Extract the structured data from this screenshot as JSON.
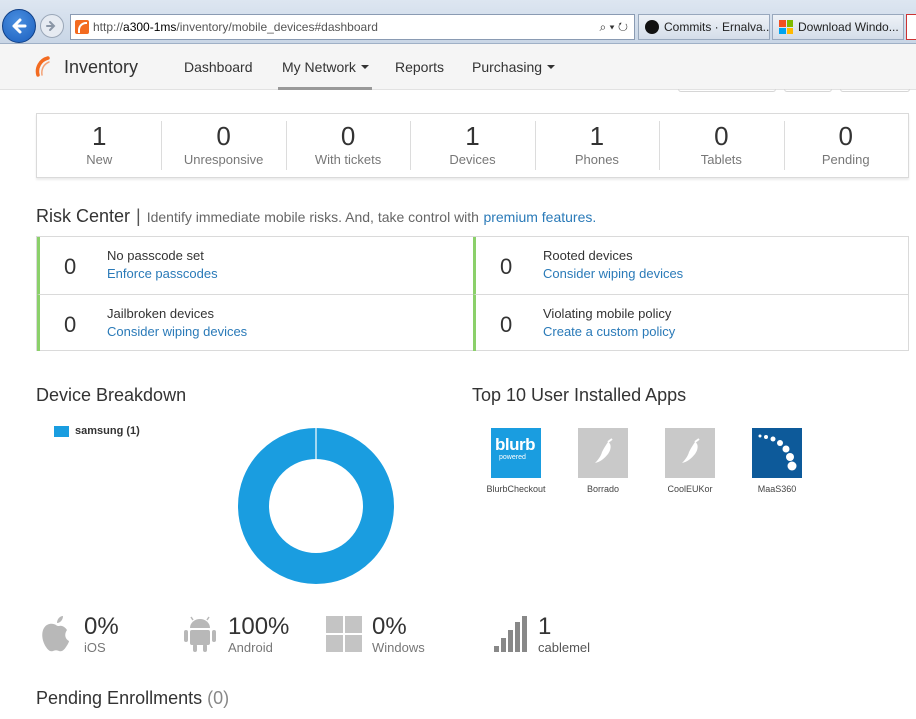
{
  "browser": {
    "url_prefix": "http://",
    "url_host": "a300-1ms",
    "url_path": "/inventory/mobile_devices#dashboard",
    "url_tools": "⌕ ▾ ↻",
    "tabs": [
      {
        "label": "Commits · Ernalva..."
      },
      {
        "label": "Download Windo..."
      }
    ]
  },
  "app": {
    "brand": "Inventory",
    "nav": [
      {
        "label": "Dashboard"
      },
      {
        "label": "My Network"
      },
      {
        "label": "Reports"
      },
      {
        "label": "Purchasing"
      }
    ]
  },
  "stats": [
    {
      "value": "1",
      "label": "New"
    },
    {
      "value": "0",
      "label": "Unresponsive"
    },
    {
      "value": "0",
      "label": "With tickets"
    },
    {
      "value": "1",
      "label": "Devices"
    },
    {
      "value": "1",
      "label": "Phones"
    },
    {
      "value": "0",
      "label": "Tablets"
    },
    {
      "value": "0",
      "label": "Pending"
    }
  ],
  "risk": {
    "title": "Risk Center",
    "separator": "|",
    "subtitle": "Identify immediate mobile risks. And, take control with",
    "link": "premium features.",
    "items": [
      {
        "count": "0",
        "title": "No passcode set",
        "action": "Enforce passcodes"
      },
      {
        "count": "0",
        "title": "Rooted devices",
        "action": "Consider wiping devices"
      },
      {
        "count": "0",
        "title": "Jailbroken devices",
        "action": "Consider wiping devices"
      },
      {
        "count": "0",
        "title": "Violating mobile policy",
        "action": "Create a custom policy"
      }
    ]
  },
  "breakdown": {
    "title": "Device Breakdown",
    "legend": "samsung (1)",
    "color": "#1a9de0"
  },
  "apps": {
    "title": "Top 10 User Installed Apps",
    "blurb_word": "blurb",
    "blurb_sub": "powered",
    "items": [
      {
        "name": "BlurbCheckout"
      },
      {
        "name": "Borrado"
      },
      {
        "name": "CoolEUKor"
      },
      {
        "name": "MaaS360"
      }
    ]
  },
  "platforms": [
    {
      "value": "0%",
      "label": "iOS",
      "icon": "apple-icon"
    },
    {
      "value": "100%",
      "label": "Android",
      "icon": "android-icon"
    },
    {
      "value": "0%",
      "label": "Windows",
      "icon": "windows-icon"
    },
    {
      "value": "1",
      "label": "cablemel",
      "icon": "signal-bars-icon"
    }
  ],
  "pending": {
    "title": "Pending Enrollments",
    "count": "(0)"
  }
}
